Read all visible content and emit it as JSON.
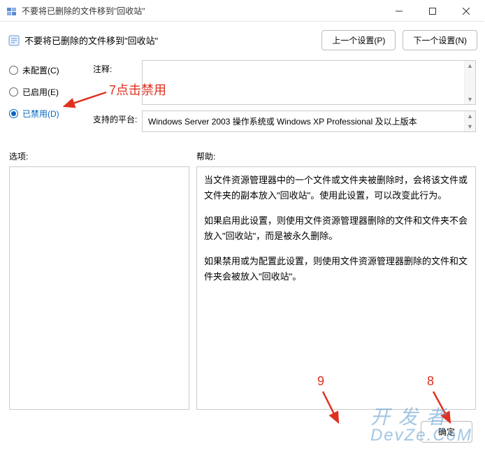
{
  "window": {
    "title": "不要将已删除的文件移到\"回收站\""
  },
  "header": {
    "subtitle": "不要将已删除的文件移到\"回收站\"",
    "prev_button": "上一个设置(P)",
    "next_button": "下一个设置(N)"
  },
  "config": {
    "radio_not_configured": "未配置(C)",
    "radio_enabled": "已启用(E)",
    "radio_disabled": "已禁用(D)",
    "comment_label": "注释:",
    "platform_label": "支持的平台:",
    "platform_value": "Windows Server 2003 操作系统或 Windows XP Professional 及以上版本"
  },
  "columns": {
    "options_label": "选项:",
    "help_label": "帮助:"
  },
  "help": {
    "p1": "当文件资源管理器中的一个文件或文件夹被删除时，会将该文件或文件夹的副本放入\"回收站\"。使用此设置，可以改变此行为。",
    "p2": "如果启用此设置，则使用文件资源管理器删除的文件和文件夹不会放入\"回收站\"，而是被永久删除。",
    "p3": "如果禁用或为配置此设置，则使用文件资源管理器删除的文件和文件夹会被放入\"回收站\"。"
  },
  "footer": {
    "ok": "确定"
  },
  "annotations": {
    "a7": "7点击禁用",
    "a8": "8",
    "a9": "9"
  },
  "watermark": {
    "line1": "开 发 者",
    "line2": "DevZe.CoM"
  }
}
